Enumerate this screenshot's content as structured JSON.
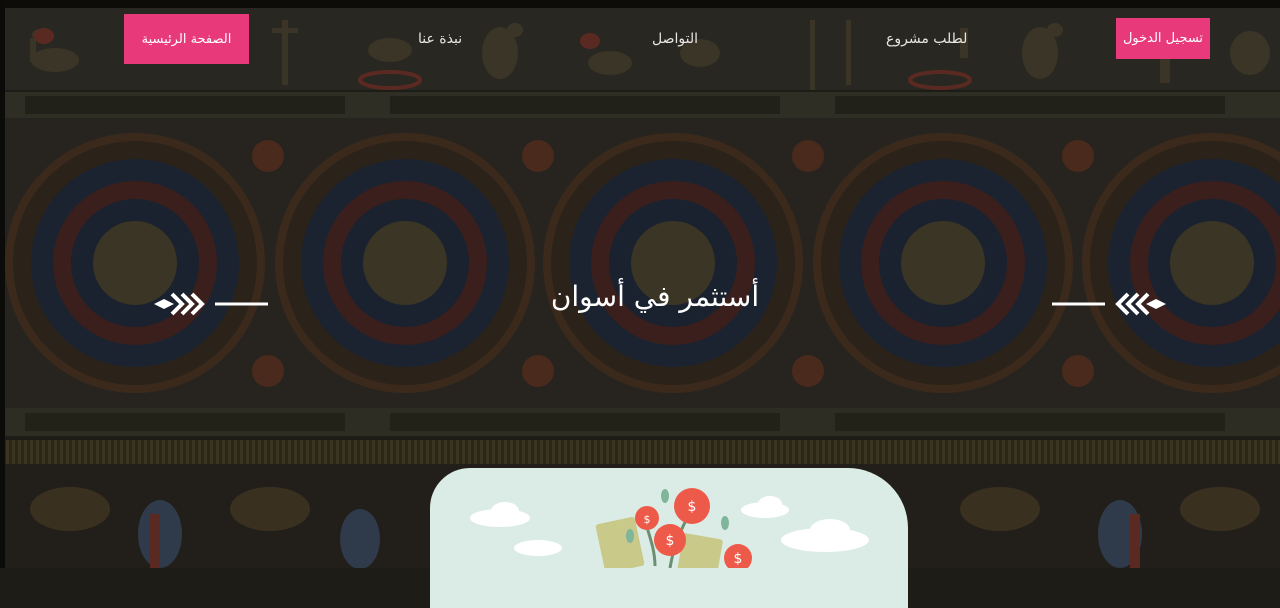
{
  "nav": {
    "home_button": "الصفحة الرئيسية",
    "about": "نبذة عنا",
    "contact": "التواصل",
    "project_request": "لطلب مشروع",
    "login_button": "تسجيل الدخول"
  },
  "hero": {
    "title": "أستثمر في أسوان"
  },
  "colors": {
    "accent": "#e83a7a",
    "background": "#1d1c17",
    "card": "#dbece6"
  },
  "icons": {
    "left_ornament": "arrow-chevrons-icon",
    "right_ornament": "arrow-chevrons-icon",
    "coin": "dollar-coin-icon",
    "money": "banknote-icon"
  }
}
